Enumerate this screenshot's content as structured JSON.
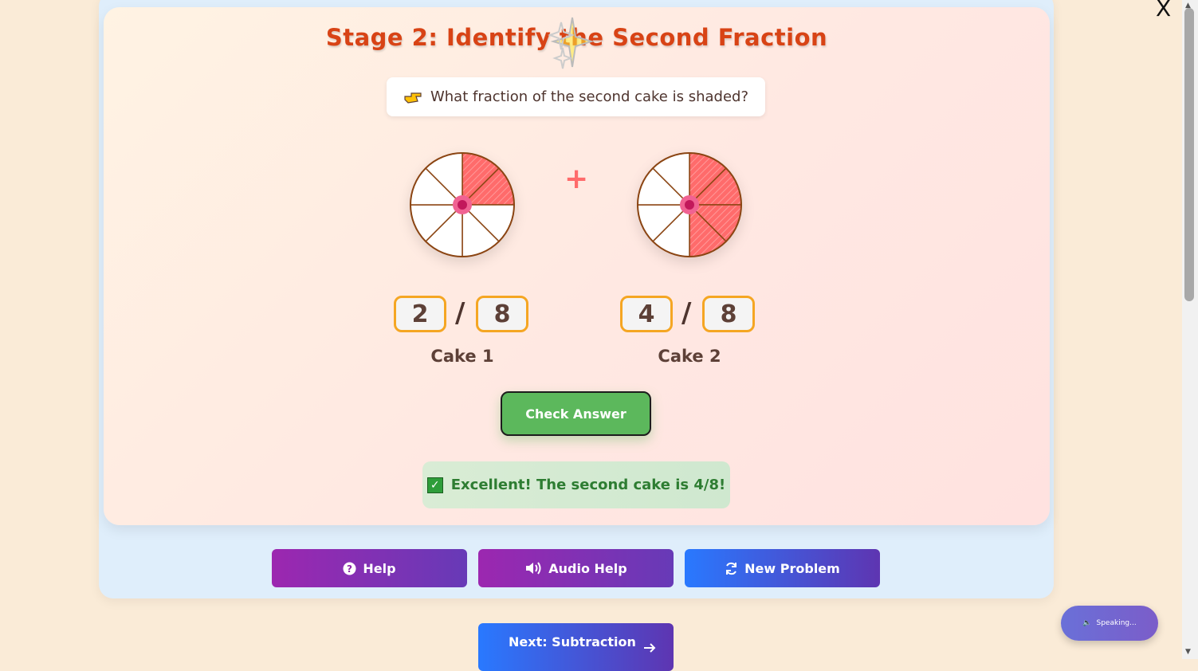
{
  "stage": {
    "title": "Stage 2: Identify the Second Fraction",
    "prompt_icon": "pointing-hand-icon",
    "prompt": "What fraction of the second cake is shaded?"
  },
  "operator": "+",
  "cakes": [
    {
      "label": "Cake 1",
      "numerator": "2",
      "slash": "/",
      "denominator": "8",
      "shaded_slices": 2,
      "total_slices": 8
    },
    {
      "label": "Cake 2",
      "numerator": "4",
      "slash": "/",
      "denominator": "8",
      "shaded_slices": 4,
      "total_slices": 8
    }
  ],
  "check_button": "Check Answer",
  "feedback": {
    "icon": "check-box-icon",
    "text": "Excellent! The second cake is 4/8!"
  },
  "toolbar": {
    "help": "Help",
    "audio_help": "Audio Help",
    "new_problem": "New Problem"
  },
  "next_button": "Next: Subtraction",
  "close_label": "X",
  "speaking_label": "Speaking...",
  "colors": {
    "title": "#d84315",
    "slice_shaded": "#ff6b6b",
    "slice_border": "#8b4513",
    "success": "#5cb85c",
    "help_gradient": "#9c27b0",
    "new_gradient": "#2979ff"
  }
}
